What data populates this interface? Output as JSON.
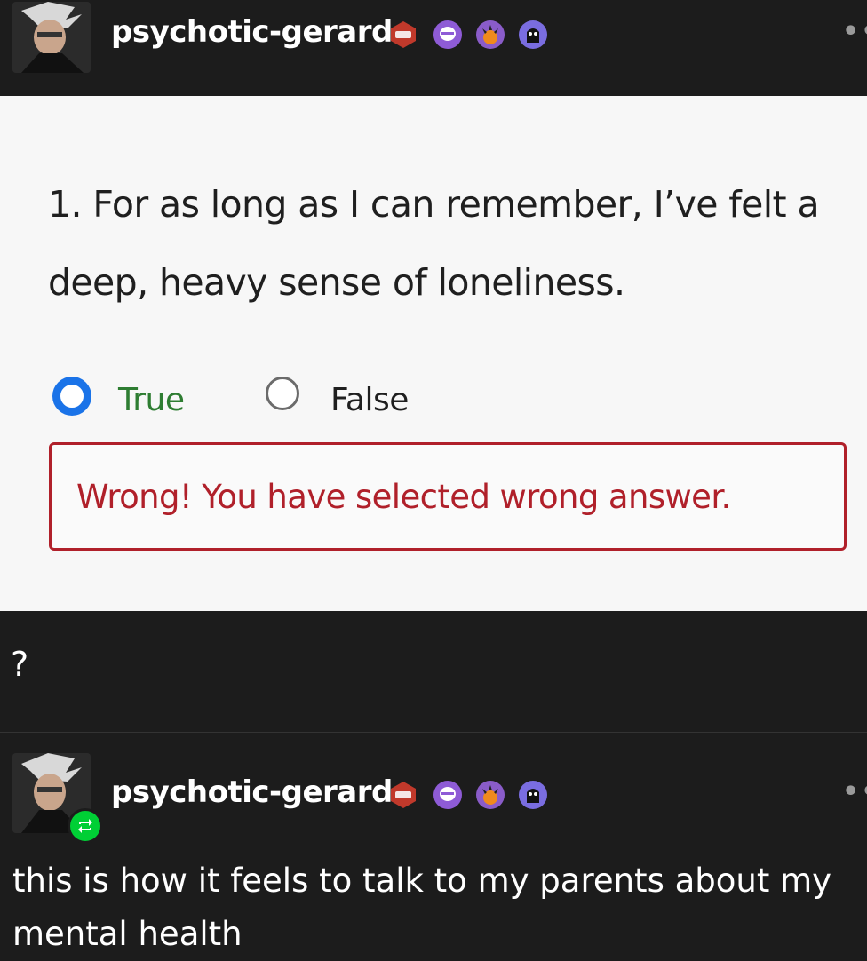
{
  "post_top": {
    "username": "psychotic-gerard",
    "more": "••",
    "badges": [
      "red-badge-icon",
      "purple-shell-icon",
      "sun-orb-icon",
      "ghost-orb-icon"
    ]
  },
  "quiz": {
    "question": "1. For as long as I can remember, I’ve felt a deep, heavy sense of loneliness.",
    "option_true": "True",
    "option_false": "False",
    "selected": "True",
    "feedback": "Wrong! You have selected wrong answer.",
    "colors": {
      "selected_radio": "#1a73e8",
      "true_text": "#2e7d32",
      "error": "#b0202a"
    }
  },
  "caption": "?",
  "post_reblog": {
    "username": "psychotic-gerard",
    "more": "••",
    "comment": "this is how it feels to talk to my parents about my mental health",
    "reblog_icon": "reblog-icon"
  }
}
